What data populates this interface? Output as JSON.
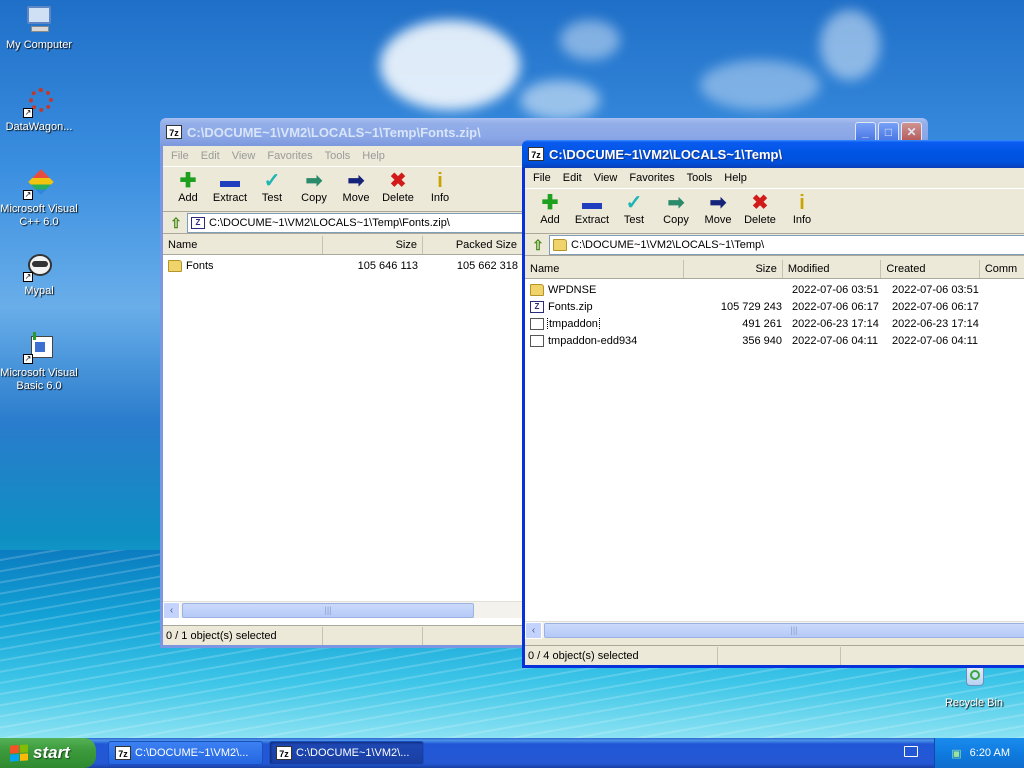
{
  "desktop": {
    "icons": [
      {
        "label": "My Computer"
      },
      {
        "label": "DataWagon..."
      },
      {
        "label": "Microsoft Visual C++ 6.0"
      },
      {
        "label": "Mypal"
      },
      {
        "label": "Microsoft Visual Basic 6.0"
      },
      {
        "label": "Recycle Bin"
      }
    ]
  },
  "window_zip": {
    "title": "C:\\DOCUME~1\\VM2\\LOCALS~1\\Temp\\Fonts.zip\\",
    "menu": [
      "File",
      "Edit",
      "View",
      "Favorites",
      "Tools",
      "Help"
    ],
    "toolbar": [
      "Add",
      "Extract",
      "Test",
      "Copy",
      "Move",
      "Delete",
      "Info"
    ],
    "address": "C:\\DOCUME~1\\VM2\\LOCALS~1\\Temp\\Fonts.zip\\",
    "columns": [
      "Name",
      "Size",
      "Packed Size"
    ],
    "rows": [
      {
        "name": "Fonts",
        "size": "105 646 113",
        "packed": "105 662 318"
      }
    ],
    "status": "0 / 1 object(s) selected"
  },
  "window_temp": {
    "title": "C:\\DOCUME~1\\VM2\\LOCALS~1\\Temp\\",
    "menu": [
      "File",
      "Edit",
      "View",
      "Favorites",
      "Tools",
      "Help"
    ],
    "toolbar": [
      "Add",
      "Extract",
      "Test",
      "Copy",
      "Move",
      "Delete",
      "Info"
    ],
    "address": "C:\\DOCUME~1\\VM2\\LOCALS~1\\Temp\\",
    "columns": [
      "Name",
      "Size",
      "Modified",
      "Created",
      "Comm"
    ],
    "rows": [
      {
        "name": "WPDNSE",
        "size": "",
        "modified": "2022-07-06 03:51",
        "created": "2022-07-06 03:51"
      },
      {
        "name": "Fonts.zip",
        "size": "105 729 243",
        "modified": "2022-07-06 06:17",
        "created": "2022-07-06 06:17"
      },
      {
        "name": "tmpaddon",
        "size": "491 261",
        "modified": "2022-06-23 17:14",
        "created": "2022-06-23 17:14"
      },
      {
        "name": "tmpaddon-edd934",
        "size": "356 940",
        "modified": "2022-07-06 04:11",
        "created": "2022-07-06 04:11"
      }
    ],
    "status": "0 / 4 object(s) selected"
  },
  "taskbar": {
    "start_label": "start",
    "tasks": [
      "C:\\DOCUME~1\\VM2\\...",
      "C:\\DOCUME~1\\VM2\\..."
    ],
    "clock": "6:20 AM"
  },
  "icons": {
    "app_badge": "7z"
  }
}
